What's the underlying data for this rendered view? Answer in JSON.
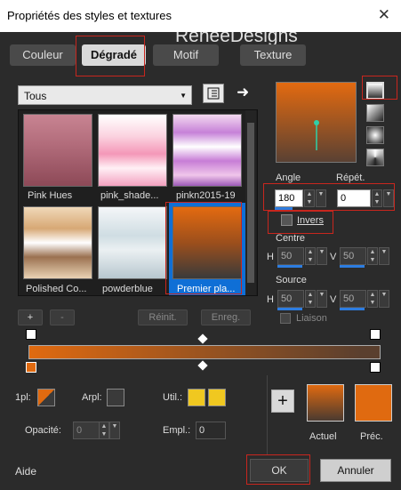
{
  "window": {
    "title": "Propriétés des styles et textures",
    "close": "✕"
  },
  "watermark": "ReneeDesigns",
  "tabs": [
    {
      "label": "Couleur"
    },
    {
      "label": "Dégradé"
    },
    {
      "label": "Motif"
    },
    {
      "label": "Texture"
    }
  ],
  "category": {
    "value": "Tous"
  },
  "thumbnails": [
    {
      "label": "Pink Hues"
    },
    {
      "label": "pink_shade..."
    },
    {
      "label": "pinkn2015-19"
    },
    {
      "label": "Polished Co..."
    },
    {
      "label": "powderblue"
    },
    {
      "label": "Premier pla..."
    }
  ],
  "gradient_buttons": {
    "add": "+",
    "remove": "-",
    "reset": "Réinit.",
    "save": "Enreg."
  },
  "angle": {
    "label": "Angle",
    "value": "180"
  },
  "repeat": {
    "label": "Répét.",
    "value": "0"
  },
  "invert": {
    "label": "Invers"
  },
  "centre": {
    "label": "Centre",
    "h_label": "H",
    "h_value": "50",
    "v_label": "V",
    "v_value": "50"
  },
  "source": {
    "label": "Source",
    "h_label": "H",
    "h_value": "50",
    "v_label": "V",
    "v_value": "50"
  },
  "link": {
    "label": "Liaison"
  },
  "stops": {
    "opl_label": "1pl:",
    "arpl_label": "Arpl:",
    "util_label": "Util.:",
    "opacity_label": "Opacité:",
    "opacity_value": "0",
    "empl_label": "Empl.:",
    "empl_value": "0"
  },
  "preview": {
    "current_label": "Actuel",
    "previous_label": "Préc.",
    "plus": "+"
  },
  "footer": {
    "help": "Aide",
    "ok": "OK",
    "cancel": "Annuler"
  },
  "colors": {
    "orange": "#e06a10",
    "dark": "#3c3c3c",
    "accent_blue": "#2d7de0",
    "highlight_red": "#c8261e",
    "yellow": "#f0c820"
  }
}
